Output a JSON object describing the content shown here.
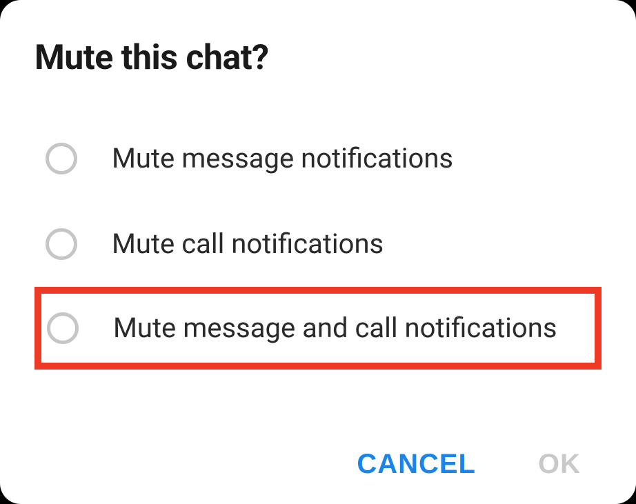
{
  "dialog": {
    "title": "Mute this chat?",
    "options": [
      {
        "label": "Mute message notifications",
        "highlighted": false
      },
      {
        "label": "Mute call notifications",
        "highlighted": false
      },
      {
        "label": "Mute message and call notifications",
        "highlighted": true
      }
    ],
    "actions": {
      "cancel": "CANCEL",
      "ok": "OK"
    }
  }
}
